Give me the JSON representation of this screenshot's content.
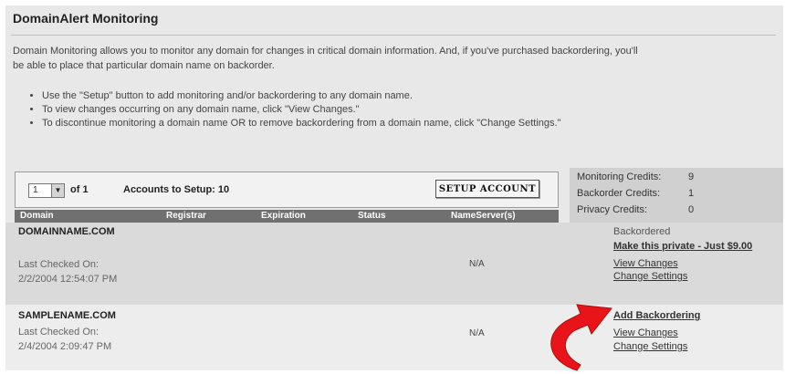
{
  "page": {
    "title": "DomainAlert Monitoring",
    "intro": "Domain Monitoring allows you to monitor any domain for changes in critical domain information. And, if you've purchased backordering, you'll be able to place that particular domain name on backorder.",
    "bullets": [
      "Use the \"Setup\" button to add monitoring and/or backordering to any domain name.",
      "To view changes occurring on any domain name, click \"View Changes.\"",
      "To discontinue monitoring a domain name OR to remove backordering from a domain name, click \"Change Settings.\""
    ]
  },
  "setup": {
    "page_value": "1",
    "of_label": "of 1",
    "accounts_label": "Accounts to Setup: 10",
    "button_label": "SETUP ACCOUNT"
  },
  "credits": [
    {
      "label": "Monitoring Credits:",
      "value": "9"
    },
    {
      "label": "Backorder Credits:",
      "value": "1"
    },
    {
      "label": "Privacy Credits:",
      "value": "0"
    }
  ],
  "table": {
    "headers": [
      "Domain",
      "Registrar",
      "Expiration",
      "Status",
      "NameServer(s)"
    ]
  },
  "rows": [
    {
      "domain": "DOMAINNAME.COM",
      "checked_label": "Last Checked On:",
      "checked_date": "2/2/2004 12:54:07 PM",
      "nameserver": "N/A",
      "status_text": "Backordered",
      "privacy_link": "Make this private - Just $9.00",
      "view_changes": "View Changes",
      "change_settings": "Change Settings"
    },
    {
      "domain": "SAMPLENAME.COM",
      "checked_label": "Last Checked On:",
      "checked_date": "2/4/2004 2:09:47 PM",
      "nameserver": "N/A",
      "add_backordering": "Add Backordering",
      "view_changes": "View Changes",
      "change_settings": "Change Settings"
    }
  ],
  "colors": {
    "arrow": "#e8141a",
    "panel": "#e8e8e8",
    "header_bar": "#707070"
  },
  "icons": {
    "dropdown": "chevron-down-icon",
    "pointer": "red-curved-arrow-icon"
  }
}
